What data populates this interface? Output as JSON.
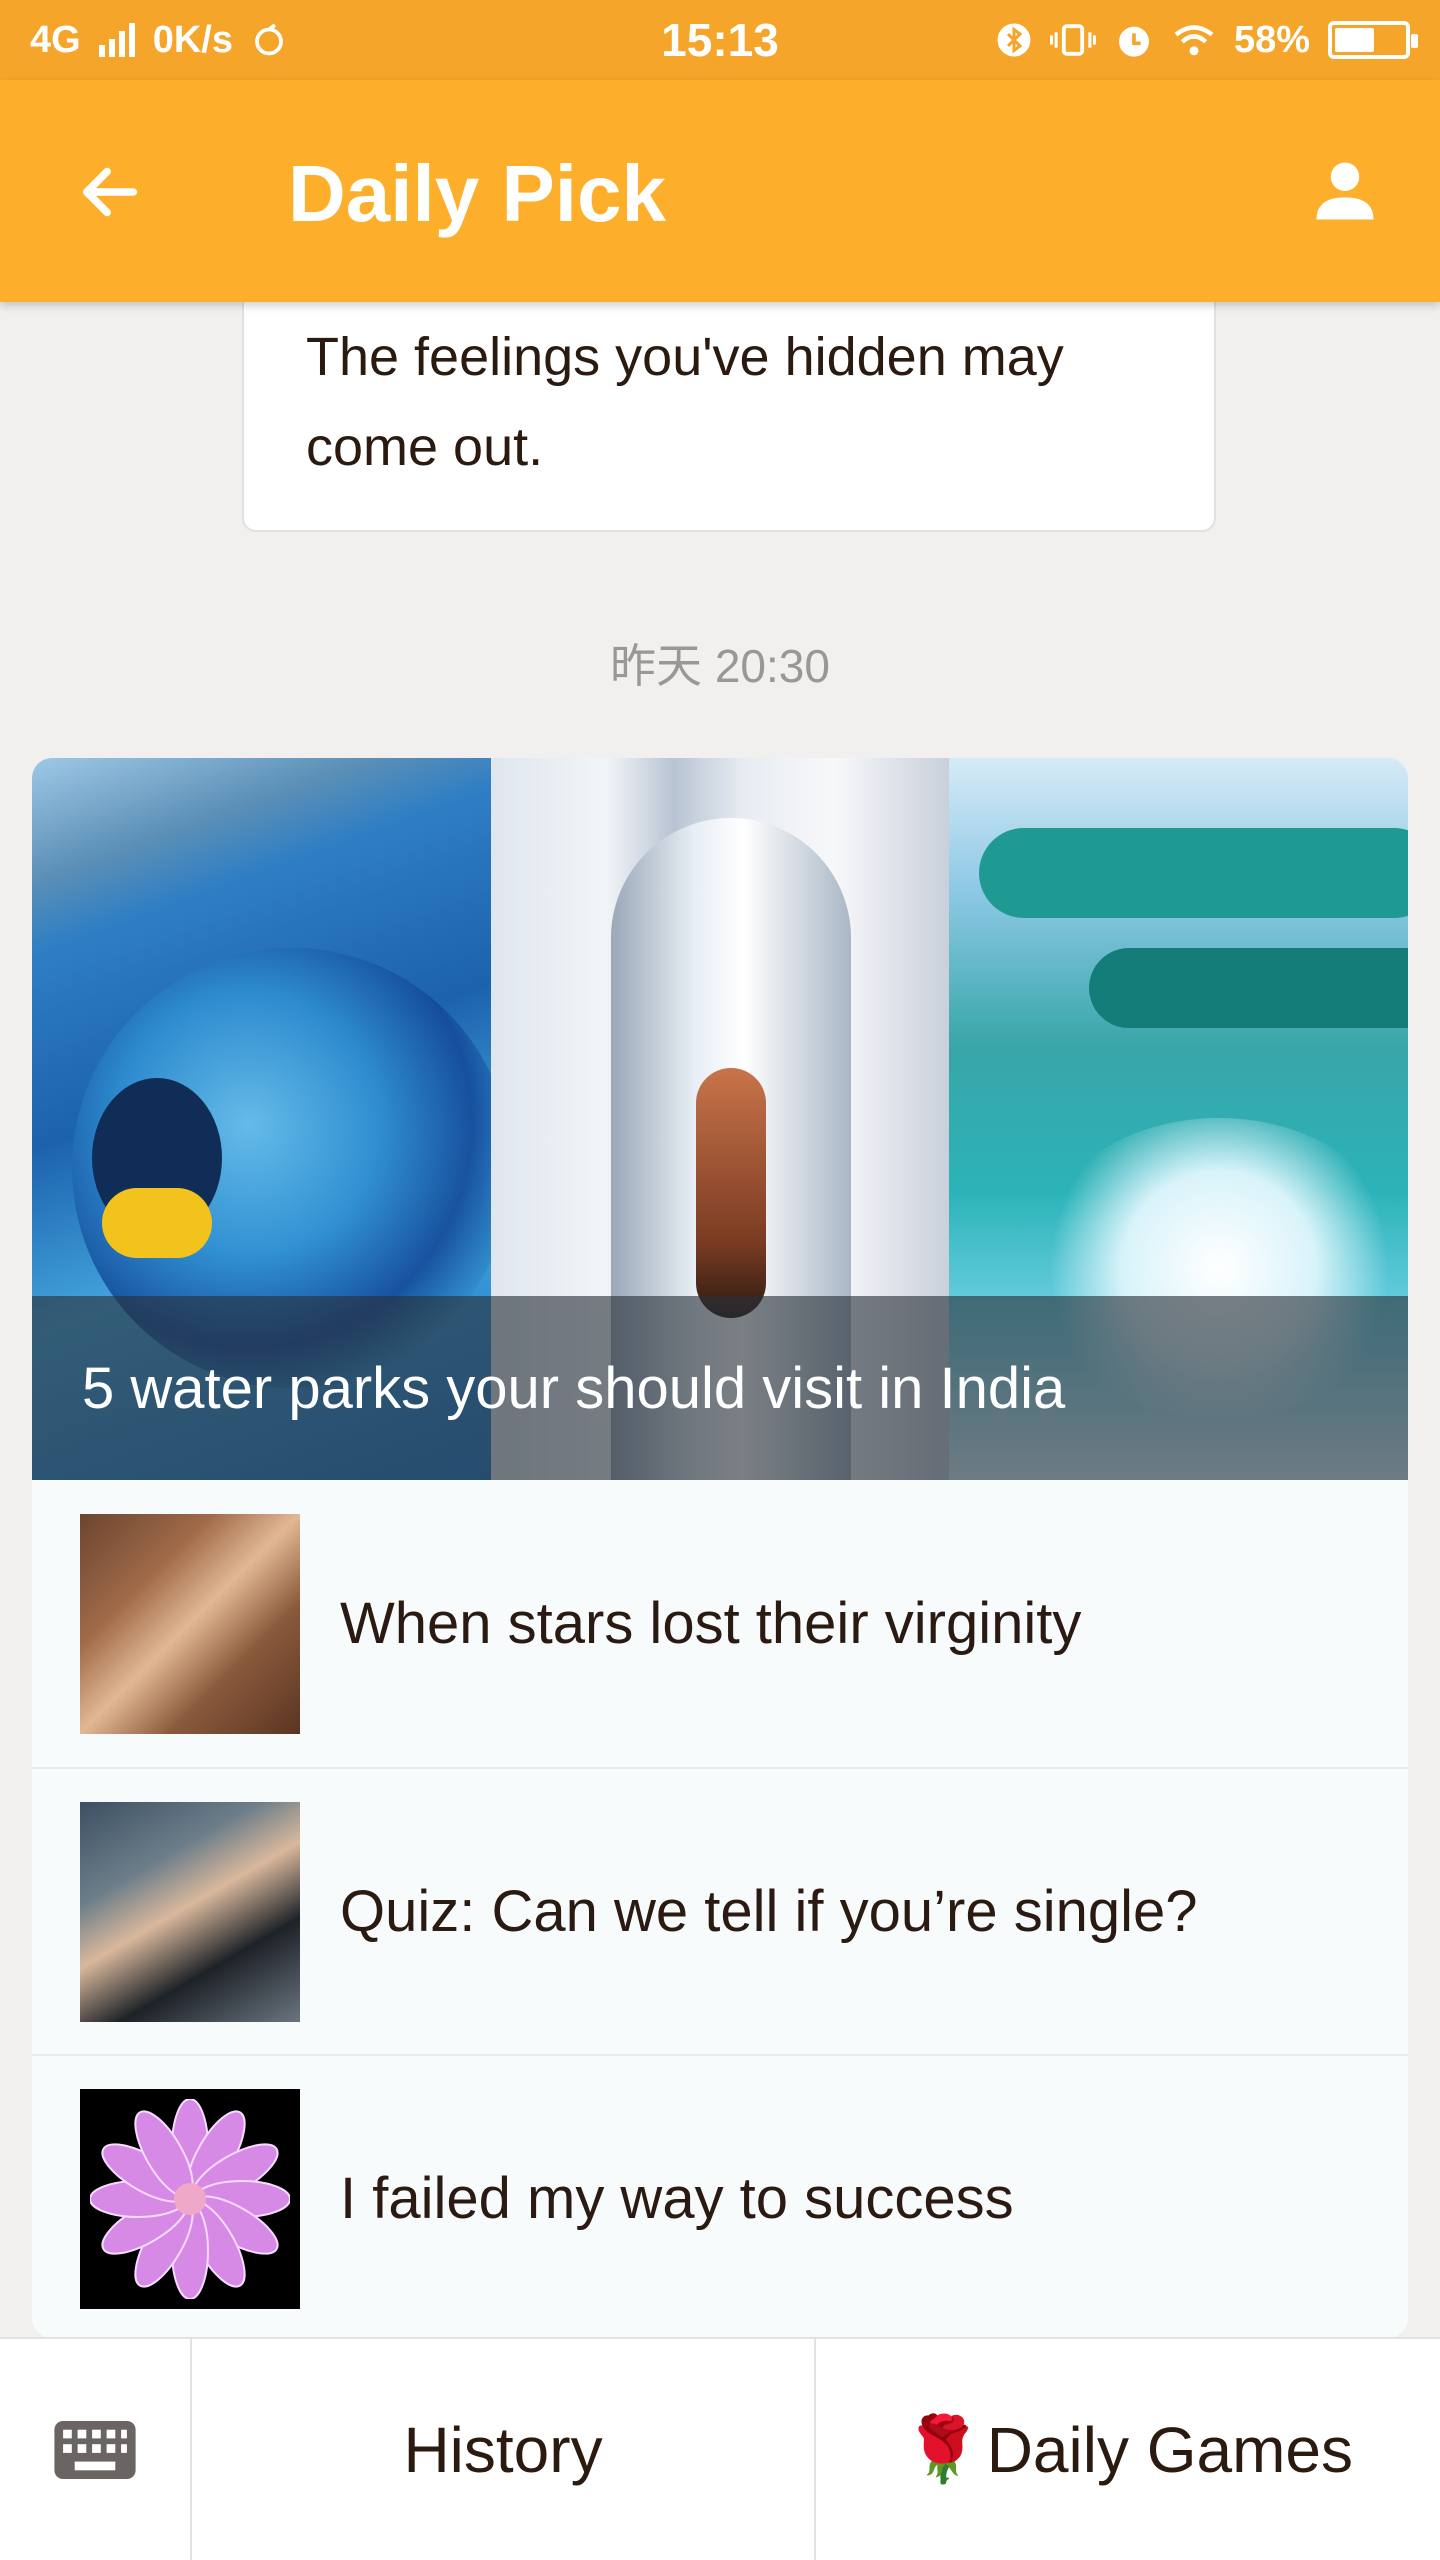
{
  "status_bar": {
    "network": "4G",
    "speed": "0K/s",
    "time": "15:13",
    "battery": "58%",
    "battery_level": 0.58
  },
  "app_bar": {
    "title": "Daily Pick",
    "back_icon": "arrow-left-icon",
    "profile_icon": "person-icon",
    "color": "#fdaf2b"
  },
  "message": {
    "text": "The feelings you've hidden may come out."
  },
  "timestamp": "昨天 20:30",
  "news": {
    "hero_caption": "5 water parks your should visit in India",
    "items": [
      {
        "headline": "When stars lost their virginity"
      },
      {
        "headline": "Quiz: Can we tell if you’re single?"
      },
      {
        "headline": "I failed my way to success"
      }
    ]
  },
  "bottom_bar": {
    "keyboard_icon": "keyboard-icon",
    "history_label": "History",
    "games_emoji": "🌹",
    "games_label": "Daily Games"
  }
}
